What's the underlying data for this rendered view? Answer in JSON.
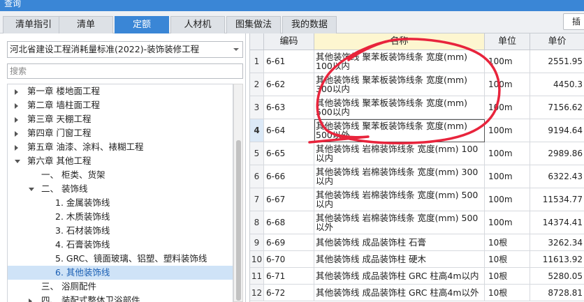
{
  "window": {
    "title": "查询"
  },
  "tabs": [
    {
      "label": "清单指引",
      "active": false
    },
    {
      "label": "清单",
      "active": false
    },
    {
      "label": "定额",
      "active": true
    },
    {
      "label": "人材机",
      "active": false
    },
    {
      "label": "图集做法",
      "active": false
    },
    {
      "label": "我的数据",
      "active": false
    }
  ],
  "insert_button": {
    "label": "插"
  },
  "library_select": {
    "value": "河北省建设工程消耗量标准(2022)-装饰装修工程"
  },
  "search": {
    "placeholder": "搜索"
  },
  "tree": [
    {
      "label": "第一章 楼地面工程",
      "level": 0,
      "state": "closed"
    },
    {
      "label": "第二章 墙柱面工程",
      "level": 0,
      "state": "closed"
    },
    {
      "label": "第三章 天棚工程",
      "level": 0,
      "state": "closed"
    },
    {
      "label": "第四章 门窗工程",
      "level": 0,
      "state": "closed"
    },
    {
      "label": "第五章 油漆、涂料、裱糊工程",
      "level": 0,
      "state": "closed"
    },
    {
      "label": "第六章 其他工程",
      "level": 0,
      "state": "open"
    },
    {
      "label": "一、 柜类、货架",
      "level": 1,
      "state": "none"
    },
    {
      "label": "二、 装饰线",
      "level": 1,
      "state": "open"
    },
    {
      "label": "1. 金属装饰线",
      "level": 2,
      "state": "none"
    },
    {
      "label": "2. 木质装饰线",
      "level": 2,
      "state": "none"
    },
    {
      "label": "3. 石材装饰线",
      "level": 2,
      "state": "none"
    },
    {
      "label": "4. 石膏装饰线",
      "level": 2,
      "state": "none"
    },
    {
      "label": "5. GRC、镜面玻璃、铝塑、塑料装饰线",
      "level": 2,
      "state": "none"
    },
    {
      "label": "6. 其他装饰线",
      "level": 2,
      "state": "none",
      "selected": true
    },
    {
      "label": "三、 浴厕配件",
      "level": 1,
      "state": "none"
    },
    {
      "label": "四、 装配式整体卫浴部件",
      "level": 1,
      "state": "closed"
    }
  ],
  "grid": {
    "headers": {
      "index": "",
      "code": "编码",
      "name": "名称",
      "unit": "单位",
      "price": "单价"
    },
    "rows": [
      {
        "index": "1",
        "code": "6-61",
        "name": "其他装饰线 聚苯板装饰线条 宽度(mm) 100以内",
        "unit": "100m",
        "price": "2551.95"
      },
      {
        "index": "2",
        "code": "6-62",
        "name": "其他装饰线 聚苯板装饰线条 宽度(mm) 300以内",
        "unit": "100m",
        "price": "4450.3"
      },
      {
        "index": "3",
        "code": "6-63",
        "name": "其他装饰线 聚苯板装饰线条 宽度(mm) 500以内",
        "unit": "100m",
        "price": "7156.62"
      },
      {
        "index": "4",
        "code": "6-64",
        "name": "其他装饰线 聚苯板装饰线条 宽度(mm) 500以外",
        "unit": "100m",
        "price": "9194.64",
        "current": true
      },
      {
        "index": "5",
        "code": "6-65",
        "name": "其他装饰线 岩棉装饰线条 宽度(mm) 100以内",
        "unit": "100m",
        "price": "2989.86"
      },
      {
        "index": "6",
        "code": "6-66",
        "name": "其他装饰线 岩棉装饰线条 宽度(mm) 300以内",
        "unit": "100m",
        "price": "6322.43"
      },
      {
        "index": "7",
        "code": "6-67",
        "name": "其他装饰线 岩棉装饰线条 宽度(mm) 500以内",
        "unit": "100m",
        "price": "11534.77"
      },
      {
        "index": "8",
        "code": "6-68",
        "name": "其他装饰线 岩棉装饰线条 宽度(mm) 500以外",
        "unit": "100m",
        "price": "14374.41"
      },
      {
        "index": "9",
        "code": "6-69",
        "name": "其他装饰线 成品装饰柱 石膏",
        "unit": "10根",
        "price": "3262.34"
      },
      {
        "index": "10",
        "code": "6-70",
        "name": "其他装饰线 成品装饰柱 硬木",
        "unit": "10根",
        "price": "11613.92"
      },
      {
        "index": "11",
        "code": "6-71",
        "name": "其他装饰线 成品装饰柱 GRC 柱高4m以内",
        "unit": "10根",
        "price": "5280.05"
      },
      {
        "index": "12",
        "code": "6-72",
        "name": "其他装饰线 成品装饰柱 GRC 柱高4m以外",
        "unit": "10根",
        "price": "8728.81"
      }
    ]
  },
  "annotation": {
    "color": "#e8243c"
  }
}
